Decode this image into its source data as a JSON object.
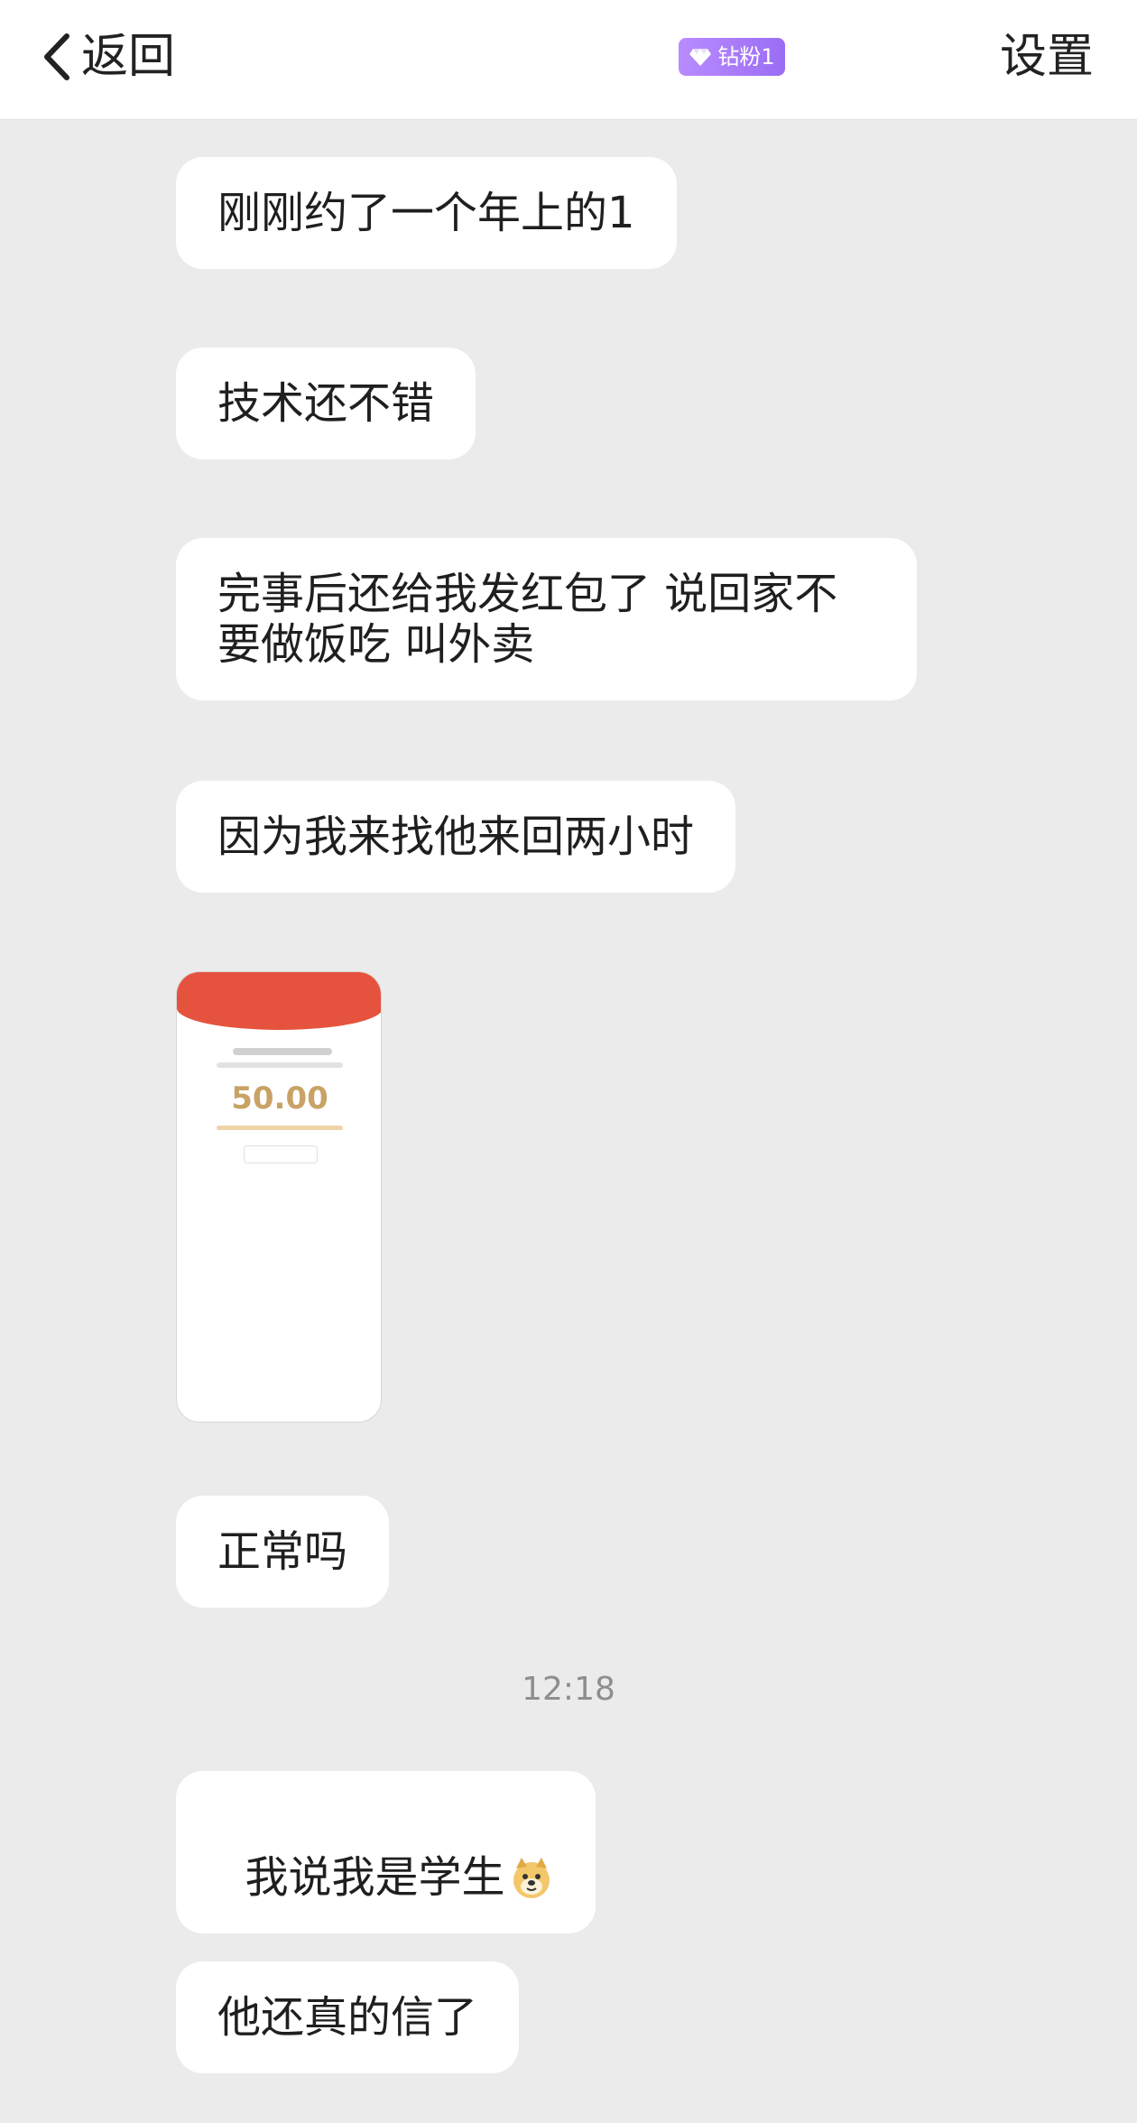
{
  "header": {
    "back_label": "返回",
    "badge_label": "钻粉1",
    "settings_label": "设置",
    "badge_color": "#a97bf8"
  },
  "messages": [
    {
      "text": "刚刚约了一个年上的1"
    },
    {
      "text": "技术还不错"
    },
    {
      "text": "完事后还给我发红包了 说回家不\n要做饭吃 叫外卖"
    },
    {
      "text": "因为我来找他来回两小时"
    },
    {
      "text": "正常吗"
    },
    {
      "text": "我说我是学生",
      "emoji": "doge-emoji"
    },
    {
      "text": "他还真的信了"
    }
  ],
  "image_message": {
    "amount": "50.00",
    "header_color": "#e5533e",
    "amount_color": "#c9a266"
  },
  "timestamp": "12:18",
  "colors": {
    "background": "#ebebeb",
    "bubble": "#ffffff"
  }
}
